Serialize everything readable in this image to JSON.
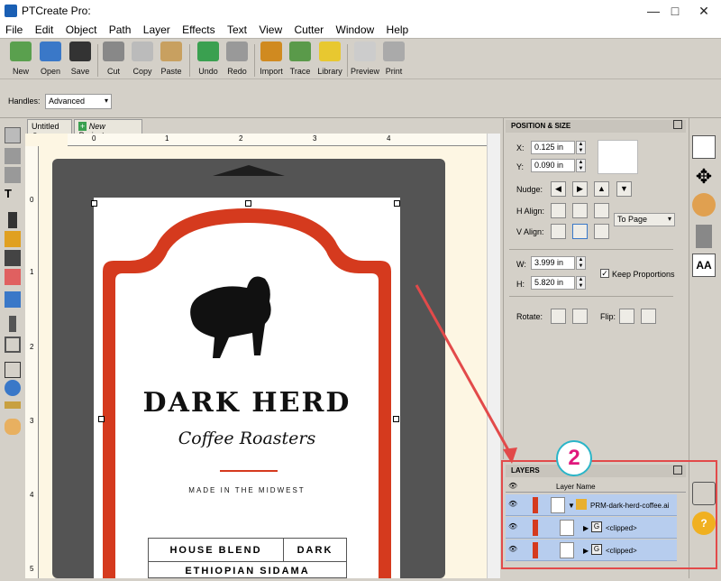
{
  "window": {
    "title": "PTCreate Pro:"
  },
  "menu": [
    "File",
    "Edit",
    "Object",
    "Path",
    "Layer",
    "Effects",
    "Text",
    "View",
    "Cutter",
    "Window",
    "Help"
  ],
  "toolbar": {
    "new": "New",
    "open": "Open",
    "save": "Save",
    "cut": "Cut",
    "copy": "Copy",
    "paste": "Paste",
    "undo": "Undo",
    "redo": "Redo",
    "import": "Import",
    "trace": "Trace",
    "library": "Library",
    "preview": "Preview",
    "print": "Print"
  },
  "handles": {
    "label": "Handles:",
    "value": "Advanced"
  },
  "tabs": [
    {
      "label": "Untitled"
    },
    {
      "label": "New Project..."
    }
  ],
  "ruler": {
    "top": [
      "0",
      "1",
      "2",
      "3",
      "4"
    ],
    "left": [
      "0",
      "1",
      "2",
      "3",
      "4",
      "5"
    ]
  },
  "artwork": {
    "brand_line1": "DARK HERD",
    "brand_line2": "Coffee Roasters",
    "tagline": "MADE IN THE MIDWEST",
    "table_row1_left": "HOUSE BLEND",
    "table_row1_right": "DARK",
    "table_row2_left": "ETHIOPIAN SIDAMA"
  },
  "position_size": {
    "header": "POSITION & SIZE",
    "x_label": "X:",
    "x_value": "0.125 in",
    "y_label": "Y:",
    "y_value": "0.090 in",
    "nudge_label": "Nudge:",
    "halign_label": "H Align:",
    "valign_label": "V Align:",
    "align_to": "To Page",
    "w_label": "W:",
    "w_value": "3.999 in",
    "h_label": "H:",
    "h_value": "5.820 in",
    "keep_proportions": "Keep Proportions",
    "rotate_label": "Rotate:",
    "flip_label": "Flip:"
  },
  "layers": {
    "header": "LAYERS",
    "column": "Layer Name",
    "rows": [
      {
        "name": "PRM-dark-herd-coffee.ai"
      },
      {
        "name": "<clipped>"
      },
      {
        "name": "<clipped>"
      }
    ]
  },
  "callout": {
    "number": "2"
  },
  "colors": {
    "accent_red": "#e24a4a",
    "label_red": "#d53a1e",
    "selection_blue": "#b7cdee",
    "callout_teal": "#2ab5c8"
  }
}
